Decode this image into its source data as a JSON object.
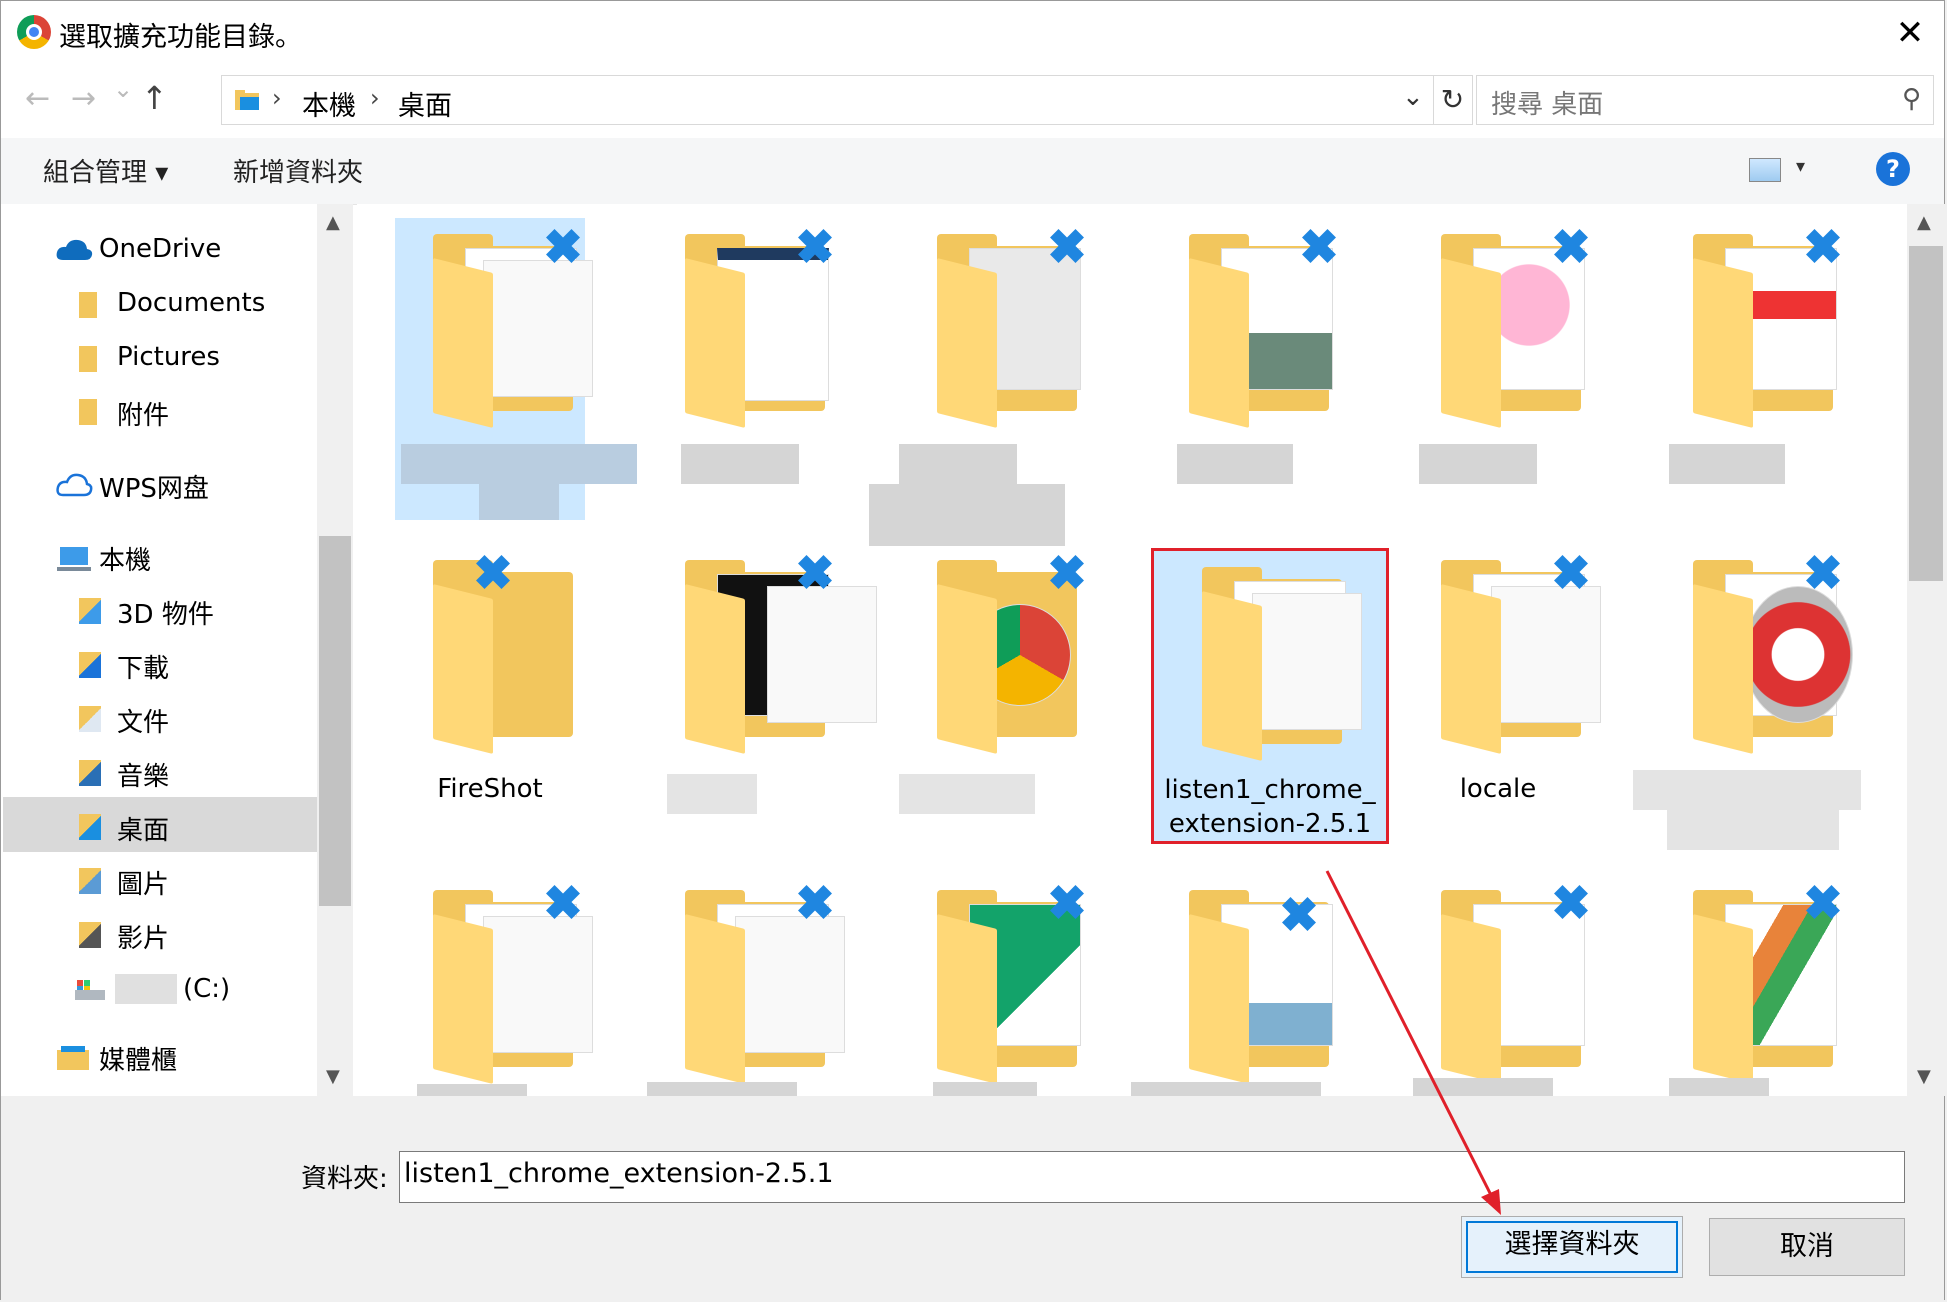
{
  "window": {
    "title": "選取擴充功能目錄。",
    "close_glyph": "✕"
  },
  "nav": {
    "back_glyph": "←",
    "forward_glyph": "→",
    "recent_glyph": "⌄",
    "up_glyph": "↑",
    "breadcrumb": [
      "本機",
      "桌面"
    ],
    "crumb_sep": "›",
    "dropdown_glyph": "⌄",
    "refresh_glyph": "↻",
    "search_placeholder": "搜尋 桌面",
    "search_glyph": "⚲"
  },
  "toolbar": {
    "organize": "組合管理 ▾",
    "new_folder": "新增資料夾",
    "view_dd": "▾",
    "help": "?"
  },
  "sidebar": {
    "items": [
      {
        "label": "OneDrive",
        "icon": "cloud-icon"
      },
      {
        "label": "Documents",
        "icon": "folder-icon"
      },
      {
        "label": "Pictures",
        "icon": "folder-icon"
      },
      {
        "label": "附件",
        "icon": "folder-icon"
      },
      {
        "label": "WPS网盘",
        "icon": "cloud-outline-icon"
      },
      {
        "label": "本機",
        "icon": "computer-icon"
      },
      {
        "label": "3D 物件",
        "icon": "folder-3d-icon"
      },
      {
        "label": "下載",
        "icon": "folder-download-icon"
      },
      {
        "label": "文件",
        "icon": "folder-documents-icon"
      },
      {
        "label": "音樂",
        "icon": "folder-music-icon"
      },
      {
        "label": "桌面",
        "icon": "folder-desktop-icon",
        "selected": true
      },
      {
        "label": "圖片",
        "icon": "folder-pictures-icon"
      },
      {
        "label": "影片",
        "icon": "folder-videos-icon"
      },
      {
        "label": "(C:)",
        "icon": "drive-icon"
      },
      {
        "label": "媒體櫃",
        "icon": "library-icon"
      }
    ],
    "scroll_up": "▲",
    "scroll_down": "▼"
  },
  "files": {
    "row2": [
      {
        "label": "FireShot"
      },
      {
        "label": ""
      },
      {
        "label": ""
      },
      {
        "label": "listen1_chrome_\nextension-2.5.1",
        "selected": true
      },
      {
        "label": "locale"
      },
      {
        "label": ""
      }
    ]
  },
  "bottom": {
    "folder_label": "資料夾:",
    "folder_value": "listen1_chrome_extension-2.5.1",
    "select_button": "選擇資料夾",
    "cancel_button": "取消"
  },
  "colors": {
    "accent": "#1a73d9",
    "selection": "#cce8ff",
    "annotation_red": "#e0202a"
  }
}
